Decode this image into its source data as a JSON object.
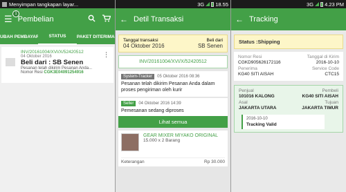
{
  "panel1": {
    "statusbar": {
      "text": "Menyimpan tangkapan layar...",
      "time": ""
    },
    "appbar": {
      "title": "Pembelian",
      "badge": "1"
    },
    "tabs": [
      "UBAH PEMBAYARAN",
      "STATUS",
      "PAKET DITERIMA"
    ],
    "order": {
      "invoice": "INV/20161004/XVI/X/52420512",
      "date": "04 Oktober 2016",
      "from": "Beli dari : SB Senen",
      "message": "Pesanan telah dikirim Pesanan Anda...",
      "resi_label": "Nomor Resi",
      "resi_value": "CGK3E04091254916"
    }
  },
  "panel2": {
    "statusbar": {
      "network": "3G",
      "time": "18.55"
    },
    "appbar": {
      "title": "Detil Transaksi"
    },
    "summary": {
      "date_label": "Tanggal transaksi",
      "date_value": "04 Oktober 2016",
      "seller_label": "Beli dari",
      "seller_value": "SB Senen"
    },
    "invoice": "INV/20161004/XVI/X/52420512",
    "tracker": {
      "tag": "System-Tracker",
      "timestamp": "05 Oktober 2016 08:36",
      "message": "Pesanan telah dikirim Pesanan Anda dalam proses pengiriman oleh kurir"
    },
    "seller": {
      "tag": "Seller",
      "timestamp": "04 Oktober 2016 14:39",
      "message": "Pemesanan sedang diproses"
    },
    "see_all": "Lihat semua",
    "product": {
      "name": "GEAR MIXER MIYAKO ORIGINAL",
      "qty": "15.000 x 2 Barang",
      "note_label": "Keterangan",
      "price": "Rp 30.000"
    }
  },
  "panel3": {
    "statusbar": {
      "network": "3G",
      "time": "4.23 PM"
    },
    "appbar": {
      "title": "Tracking"
    },
    "status": "Status :Shipping",
    "info": [
      {
        "label": "Nomor Resi",
        "value": "CGKD905626172116",
        "label2": "Tanggal di Kirim",
        "value2": "2016-10-10"
      },
      {
        "label": "Penerima",
        "value": "KG40 SITI AISAH",
        "label2": "Service Code",
        "value2": "CTC15"
      }
    ],
    "route": {
      "sender_label": "Penjual",
      "sender_value": "101016 KALONG",
      "buyer_label": "Pembeli",
      "buyer_value": "KG40 SITI AISAH",
      "origin_label": "Asal",
      "origin_value": "JAKARTA UTARA",
      "dest_label": "Tujuan",
      "dest_value": "JAKARTA TIMUR"
    },
    "history": {
      "date": "2016-10-10",
      "text": "Tracking Valid"
    }
  },
  "colors": {
    "primary": "#43a047",
    "highlight": "#fdf6c8"
  }
}
